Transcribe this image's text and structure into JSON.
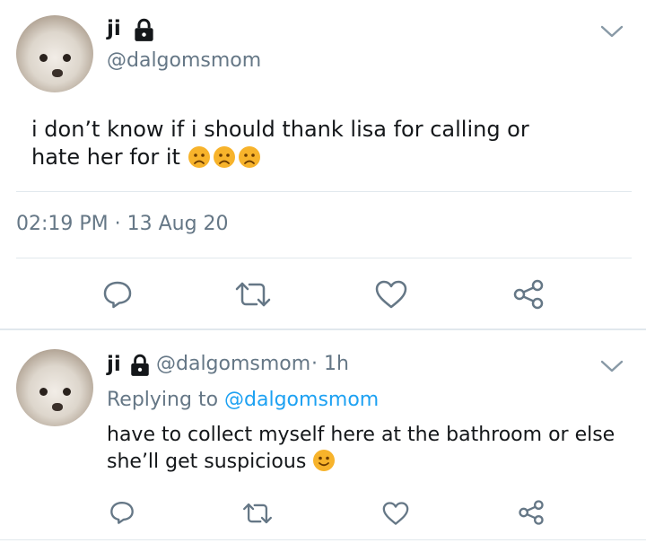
{
  "tweet": {
    "author_name": "ji",
    "author_handle": "@dalgomsmom",
    "text": "i don’t know if i should thank lisa for calling or hate her for it",
    "timestamp": "02:19 PM · 13 Aug 20",
    "emoji": [
      "worried-face",
      "worried-face",
      "worried-face"
    ]
  },
  "reply": {
    "author_name": "ji",
    "author_handle": "@dalgomsmom",
    "time_ago": "· 1h",
    "replying_prefix": "Replying to",
    "replying_to": "@dalgomsmom",
    "text": "have to collect myself here at the bathroom or else she’ll get suspicious",
    "emoji": [
      "slightly-smiling-face"
    ]
  },
  "icons": {
    "lock": "lock-icon",
    "chevron": "chevron-down-icon",
    "reply": "reply-icon",
    "retweet": "retweet-icon",
    "like": "heart-icon",
    "share": "share-icon"
  },
  "colors": {
    "text": "#14171a",
    "secondary": "#657786",
    "link": "#1da1f2",
    "divider": "#e1e8ed",
    "icon": "#657786",
    "emoji": "#f7b32b"
  }
}
